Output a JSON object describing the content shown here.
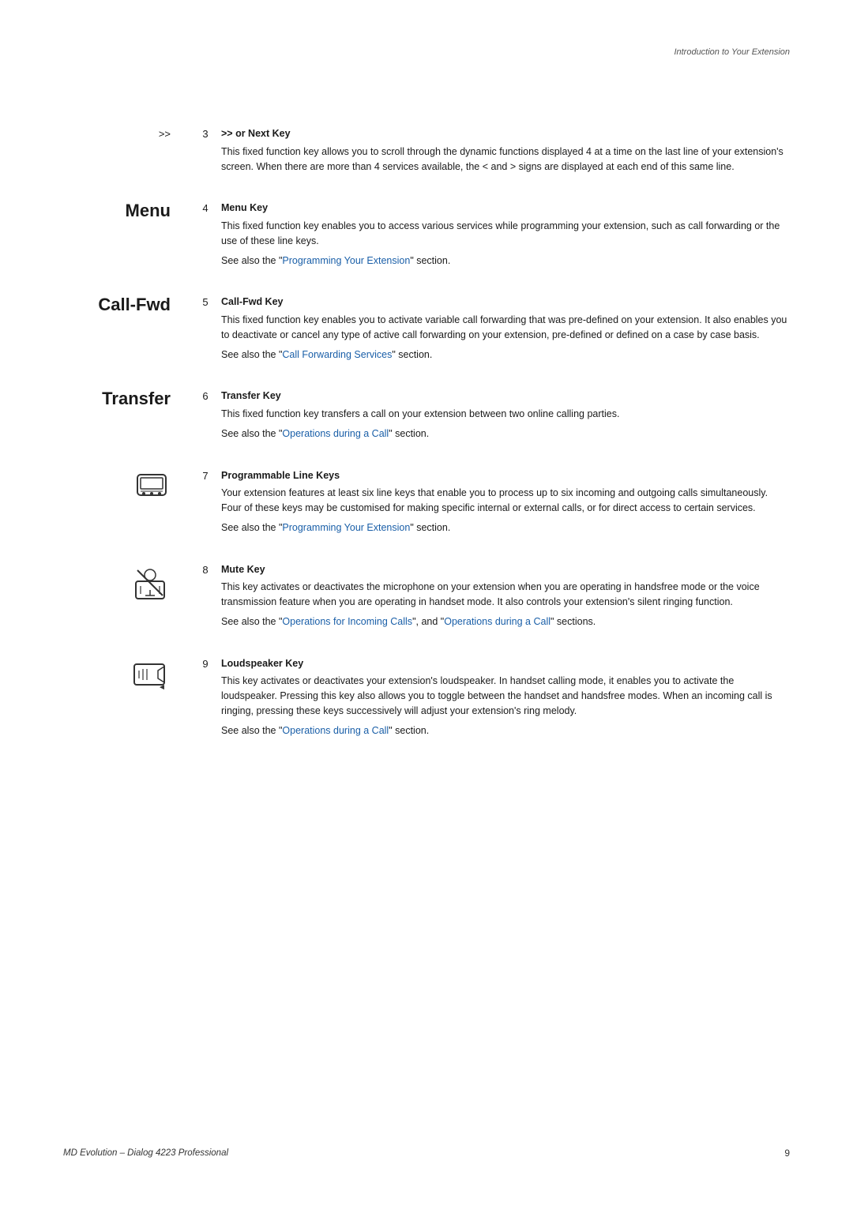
{
  "page": {
    "header_note": "Introduction to Your Extension",
    "footer_title": "MD Evolution – Dialog 4223 Professional",
    "footer_page": "9"
  },
  "entries": [
    {
      "id": "entry-next-key",
      "label": ">>",
      "label_type": "symbol",
      "number": "3",
      "key_title": ">> or Next Key",
      "description": "This fixed function key allows you to scroll through the dynamic functions displayed 4 at a time on the last line of your extension's screen. When there are more than 4 services available, the < and > signs are displayed at each end of this same line.",
      "see_also": null,
      "icon": null
    },
    {
      "id": "entry-menu-key",
      "label": "Menu",
      "label_type": "text",
      "number": "4",
      "key_title": "Menu Key",
      "description": "This fixed function key enables you to access various services while programming your extension, such as call forwarding or the use of these line keys.",
      "see_also": {
        "text": "See also the ",
        "link": "Programming Your Extension",
        "suffix": " section."
      },
      "icon": null
    },
    {
      "id": "entry-call-fwd",
      "label": "Call-Fwd",
      "label_type": "text",
      "number": "5",
      "key_title": "Call-Fwd Key",
      "description": "This fixed function key enables you to activate variable call forwarding that was pre-defined on your extension. It also enables you to deactivate or cancel any type of active call forwarding on your extension, pre-defined or defined on a case by case basis.",
      "see_also": {
        "text": "See also the ",
        "link": "Call Forwarding Services",
        "suffix": " section."
      },
      "icon": null
    },
    {
      "id": "entry-transfer",
      "label": "Transfer",
      "label_type": "text",
      "number": "6",
      "key_title": "Transfer Key",
      "description": "This fixed function key transfers a call on your extension between two online calling parties.",
      "see_also": {
        "text": "See also the ",
        "link": "Operations during a Call",
        "suffix": " section."
      },
      "icon": null
    },
    {
      "id": "entry-programmable",
      "label": null,
      "label_type": "icon",
      "icon_type": "programmable",
      "number": "7",
      "key_title": "Programmable Line Keys",
      "description": "Your extension features at least six line keys that enable you to process up to six incoming and outgoing calls simultaneously. Four of these keys may be customised for making specific internal or external calls, or for direct access to certain services.",
      "see_also": {
        "text": "See also the ",
        "link": "Programming Your Extension",
        "suffix": " section."
      }
    },
    {
      "id": "entry-mute",
      "label": null,
      "label_type": "icon",
      "icon_type": "mute",
      "number": "8",
      "key_title": "Mute Key",
      "description": "This key activates or deactivates the microphone on your extension when you are operating in handsfree mode or the voice transmission feature when you are operating in handset mode. It also controls your extension's silent ringing function.",
      "see_also": {
        "text": "See also the ",
        "link1": "Operations for Incoming Calls",
        "middle": ", and ",
        "link2": "Operations during a Call",
        "suffix": " sections."
      }
    },
    {
      "id": "entry-loudspeaker",
      "label": null,
      "label_type": "icon",
      "icon_type": "loudspeaker",
      "number": "9",
      "key_title": "Loudspeaker Key",
      "description": "This key activates or deactivates your extension's loudspeaker. In handset calling mode, it enables you to activate the loudspeaker. Pressing this key also allows you to toggle between the handset and handsfree modes. When an incoming call is ringing, pressing these keys successively will adjust your extension's ring melody.",
      "see_also": {
        "text": "See also the ",
        "link": "Operations during a Call",
        "suffix": " section."
      }
    }
  ],
  "links": {
    "programming_your_extension": "Programming Your Extension",
    "call_forwarding_services": "Call Forwarding Services",
    "operations_during_call": "Operations during a Call",
    "operations_incoming_calls": "Operations for Incoming Calls"
  }
}
